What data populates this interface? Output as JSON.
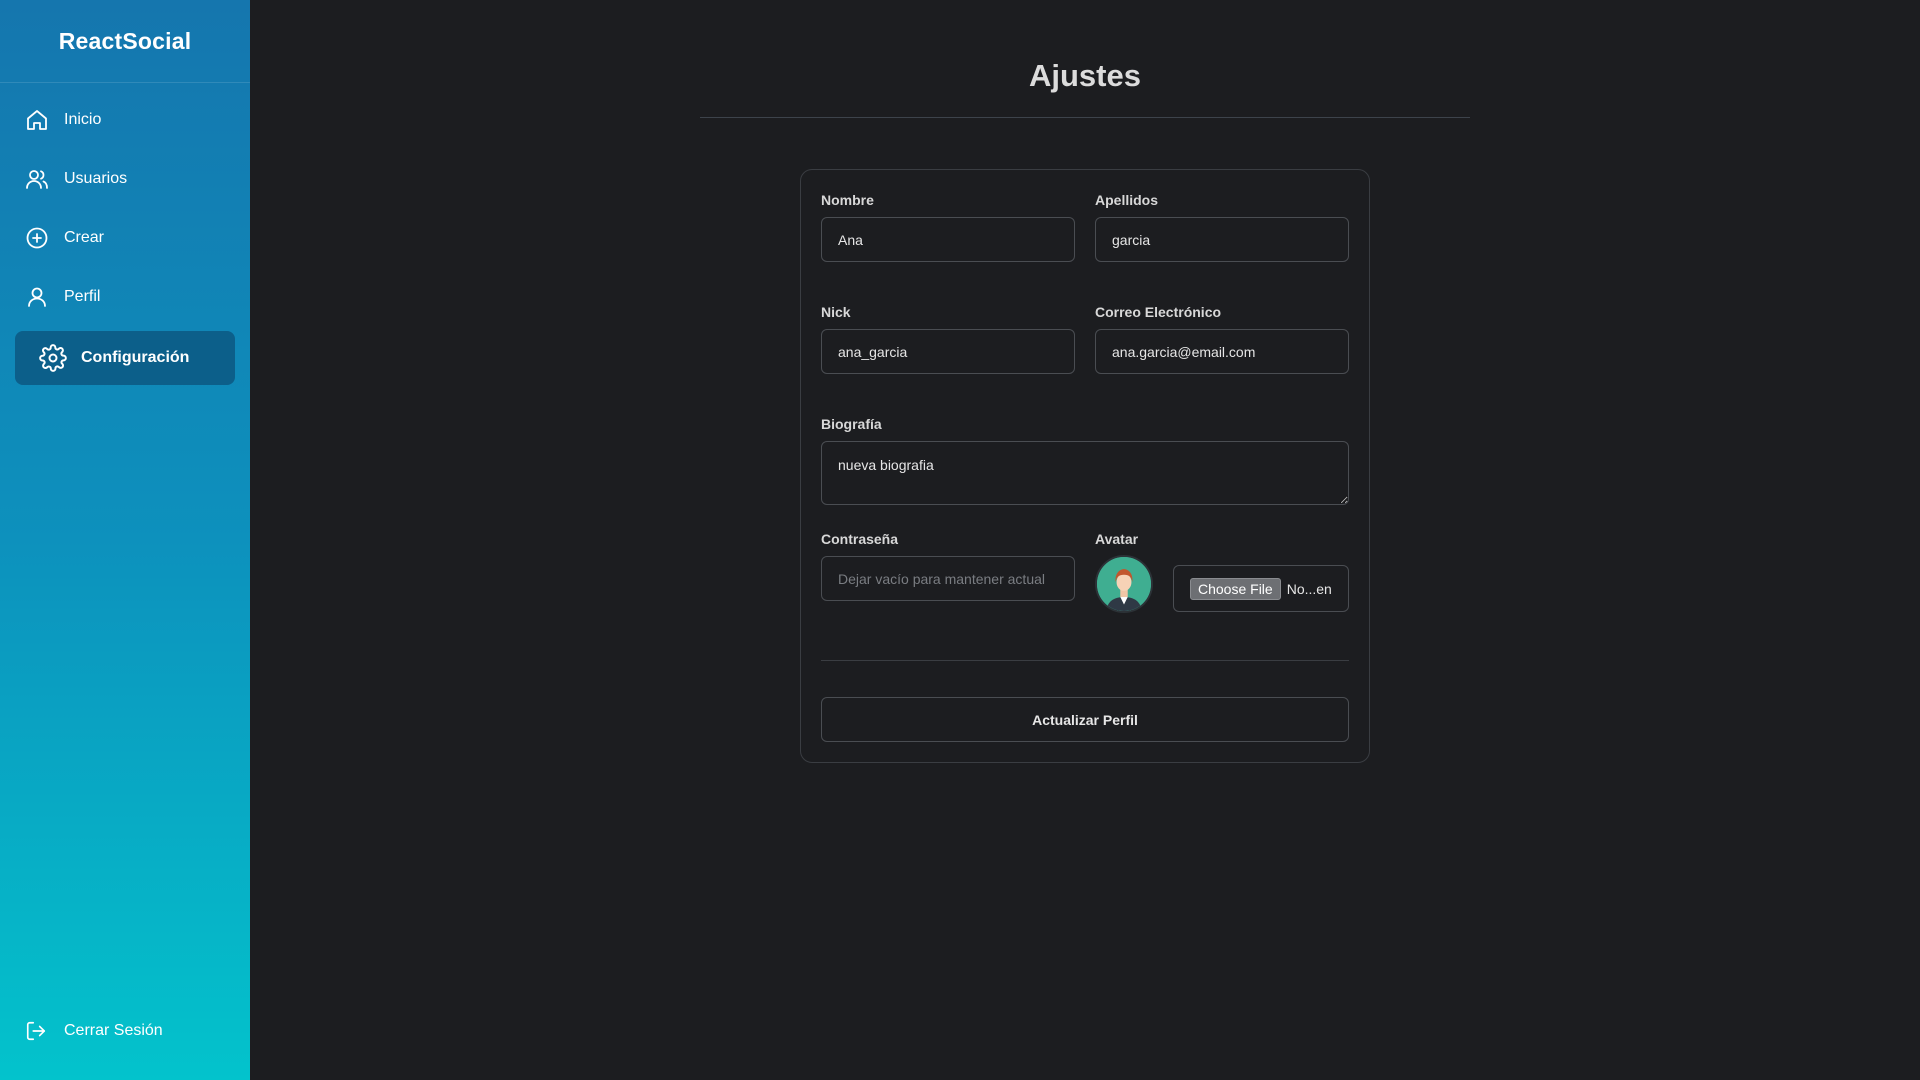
{
  "app": {
    "name": "ReactSocial"
  },
  "sidebar": {
    "items": [
      {
        "label": "Inicio",
        "icon": "home-icon"
      },
      {
        "label": "Usuarios",
        "icon": "users-icon"
      },
      {
        "label": "Crear",
        "icon": "plus-circle-icon"
      },
      {
        "label": "Perfil",
        "icon": "user-icon"
      },
      {
        "label": "Configuración",
        "icon": "gear-icon",
        "active": true
      }
    ],
    "logout_label": "Cerrar Sesión"
  },
  "page": {
    "title": "Ajustes"
  },
  "form": {
    "nombre": {
      "label": "Nombre",
      "value": "Ana"
    },
    "apellidos": {
      "label": "Apellidos",
      "value": "garcia"
    },
    "nick": {
      "label": "Nick",
      "value": "ana_garcia"
    },
    "email": {
      "label": "Correo Electrónico",
      "value": "ana.garcia@email.com"
    },
    "biografia": {
      "label": "Biografía",
      "value": "nueva biografia"
    },
    "password": {
      "label": "Contraseña",
      "value": "",
      "placeholder": "Dejar vacío para mantener actual"
    },
    "avatar": {
      "label": "Avatar",
      "choose_label": "Choose File",
      "file_name": "No...en"
    },
    "submit_label": "Actualizar Perfil"
  },
  "colors": {
    "sidebar_gradient_top": "#1576ae",
    "sidebar_gradient_bottom": "#03c3cc",
    "active_item_bg": "#0c5f8a",
    "background": "#1c1d20",
    "avatar_bg": "#3fae91"
  }
}
